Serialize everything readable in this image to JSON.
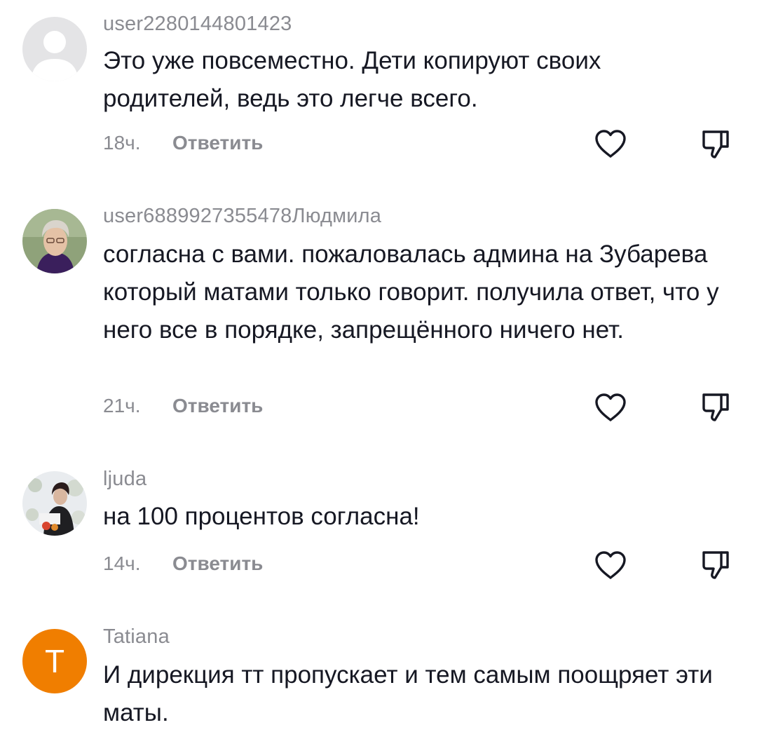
{
  "comments": [
    {
      "username": "user2280144801423",
      "text": "Это уже повсеместно. Дети копируют своих родителей, ведь это легче всего.",
      "time": "18ч.",
      "reply_label": "Ответить",
      "avatar": "default-avatar-icon"
    },
    {
      "username": "user6889927355478Людмила",
      "text": "согласна с вами. пожаловалась админа на Зубарева который матами только говорит. получила ответ, что у него все в порядке, запрещённого ничего нет.",
      "time": "21ч.",
      "reply_label": "Ответить",
      "avatar": "photo-avatar"
    },
    {
      "username": "ljuda",
      "text": "на 100 процентов согласна!",
      "time": "14ч.",
      "reply_label": "Ответить",
      "avatar": "photo-avatar"
    },
    {
      "username": "Tatiana",
      "text": "И дирекция тт пропускает и тем самым поощряет эти маты.",
      "avatar_letter": "T",
      "avatar": "letter-avatar"
    }
  ],
  "colors": {
    "text": "#161823",
    "meta": "#8a8b91",
    "icon": "#161823",
    "letter_avatar_bg": "#f07e00"
  },
  "icons": {
    "like": "heart-outline-icon",
    "dislike": "thumbs-down-outline-icon"
  }
}
